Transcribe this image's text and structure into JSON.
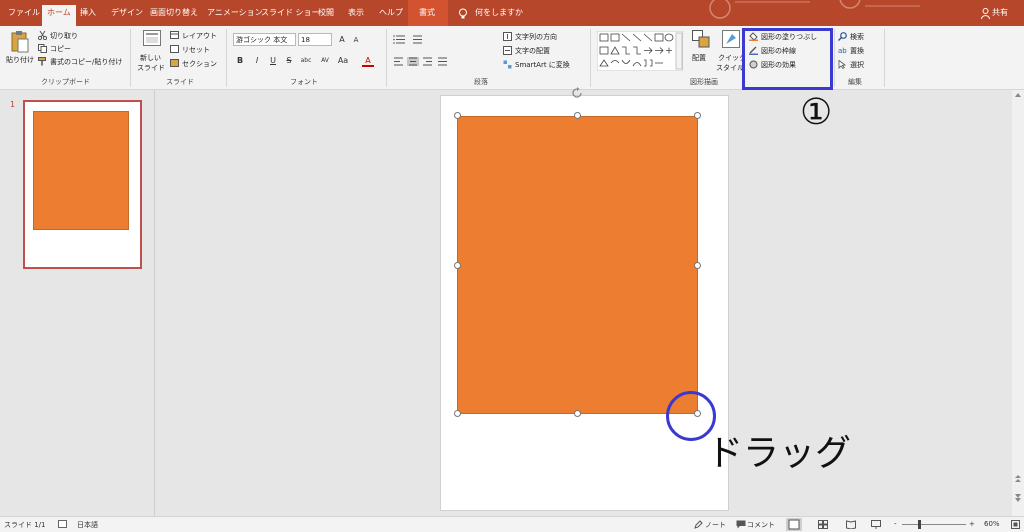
{
  "tabs": [
    "ファイル",
    "ホーム",
    "挿入",
    "デザイン",
    "画面切り替え",
    "アニメーション",
    "スライド ショー",
    "校閲",
    "表示",
    "ヘルプ",
    "書式"
  ],
  "tell_me": "何をしますか",
  "share": "共有",
  "clipboard": {
    "paste": "貼り付け",
    "cut": "切り取り",
    "copy": "コピー",
    "format_painter": "書式のコピー/貼り付け",
    "label": "クリップボード"
  },
  "slides": {
    "new_slide_1": "新しい",
    "new_slide_2": "スライド",
    "layout": "レイアウト",
    "reset": "リセット",
    "section": "セクション",
    "label": "スライド"
  },
  "font": {
    "name": "游ゴシック 本文",
    "size": "18",
    "grow": "A",
    "shrink": "A",
    "bold": "B",
    "italic": "I",
    "underline": "U",
    "strike": "S",
    "shadow": "abc",
    "spacing": "AV",
    "case": "Aa",
    "color": "A",
    "label": "フォント"
  },
  "paragraph": {
    "text_direction": "文字列の方向",
    "align_text": "文字の配置",
    "smartart": "SmartArt に変換",
    "label": "段落"
  },
  "drawing": {
    "arrange": "配置",
    "quick_style_1": "クイック",
    "quick_style_2": "スタイル",
    "fill": "図形の塗りつぶし",
    "outline": "図形の枠線",
    "effects": "図形の効果",
    "label": "図形描画"
  },
  "editing": {
    "find": "検索",
    "replace": "置換",
    "select": "選択",
    "label": "編集"
  },
  "slide_number": "1",
  "status": {
    "slide": "スライド 1/1",
    "language": "日本語",
    "notes": "ノート",
    "comments": "コメント",
    "zoom_minus": "-",
    "zoom_plus": "+",
    "zoom": "60%"
  },
  "annotations": {
    "step": "①",
    "drag": "ドラッグ"
  },
  "colors": {
    "ribbon_tab": "#b7472a",
    "shape_fill": "#ed7d31",
    "annotation": "#3a3ad0"
  }
}
